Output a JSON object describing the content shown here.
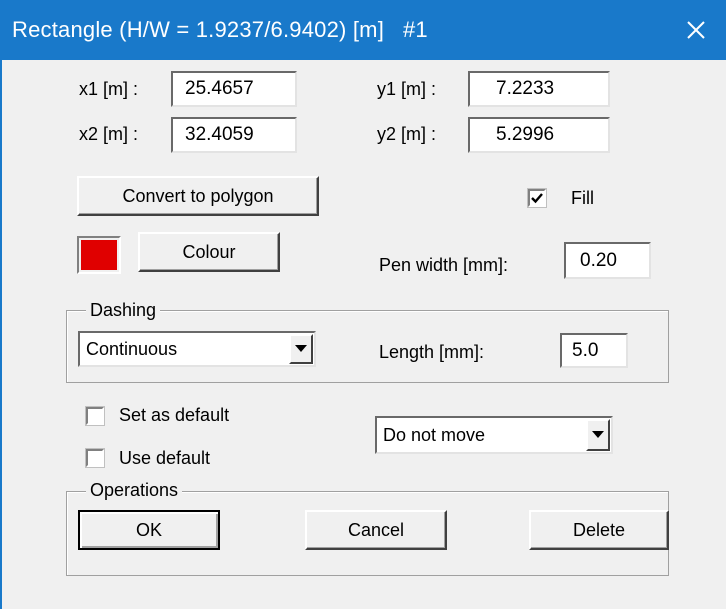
{
  "window": {
    "title": "Rectangle (H/W = 1.9237/6.9402) [m]   #1",
    "close_glyph": "✕"
  },
  "coords": {
    "x1_label": "x1 [m] :",
    "x1_value": "25.4657",
    "y1_label": "y1 [m] :",
    "y1_value": "7.2233",
    "x2_label": "x2 [m] :",
    "x2_value": "32.4059",
    "y2_label": "y2 [m] :",
    "y2_value": "5.2996"
  },
  "actions": {
    "convert_label": "Convert to polygon",
    "colour_label": "Colour",
    "fill_label": "Fill",
    "fill_checked": true
  },
  "colour": {
    "swatch": "#e00000"
  },
  "pen": {
    "label": "Pen width [mm]:",
    "value": "0.20"
  },
  "dashing": {
    "group_label": "Dashing",
    "style_selected": "Continuous",
    "length_label": "Length [mm]:",
    "length_value": "5.0"
  },
  "defaults": {
    "set_label": "Set as default",
    "set_checked": false,
    "use_label": "Use default",
    "use_checked": false,
    "move_selected": "Do not move"
  },
  "operations": {
    "group_label": "Operations",
    "ok_label": "OK",
    "cancel_label": "Cancel",
    "delete_label": "Delete"
  },
  "theme": {
    "titlebar": "#1979ca",
    "dialog_bg": "#f0f0f0"
  }
}
